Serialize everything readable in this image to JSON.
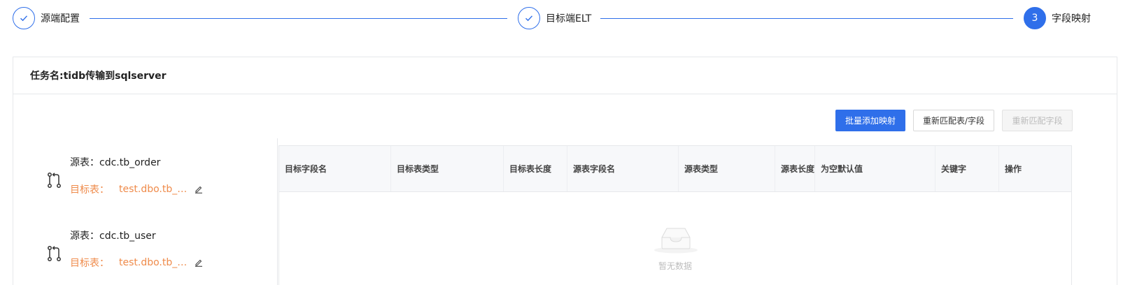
{
  "steps": [
    {
      "label": "源端配置",
      "status": "done",
      "icon": "check-icon"
    },
    {
      "label": "目标端ELT",
      "status": "done",
      "icon": "check-icon"
    },
    {
      "label": "字段映射",
      "status": "active",
      "number": "3"
    }
  ],
  "task": {
    "title": "任务名:tidb传输到sqlserver"
  },
  "toolbar": {
    "batch_add": "批量添加映射",
    "rematch_table_field": "重新匹配表/字段",
    "rematch_field": "重新匹配字段"
  },
  "mappings": [
    {
      "source_label": "源表：",
      "source": "cdc.tb_order",
      "target_label": "目标表：",
      "target": "test.dbo.tb_order",
      "target_display": "test.dbo.tb_or···"
    },
    {
      "source_label": "源表：",
      "source": "cdc.tb_user",
      "target_label": "目标表：",
      "target": "test.dbo.tb_user",
      "target_display": "test.dbo.tb_user"
    }
  ],
  "table": {
    "columns": [
      "目标字段名",
      "目标表类型",
      "目标表长度",
      "源表字段名",
      "源表类型",
      "源表长度",
      "为空默认值",
      "关键字",
      "操作"
    ],
    "empty_text": "暂无数据"
  },
  "colors": {
    "primary": "#2f6fea",
    "target_text": "#ef8b4b",
    "border": "#e6e8eb"
  }
}
